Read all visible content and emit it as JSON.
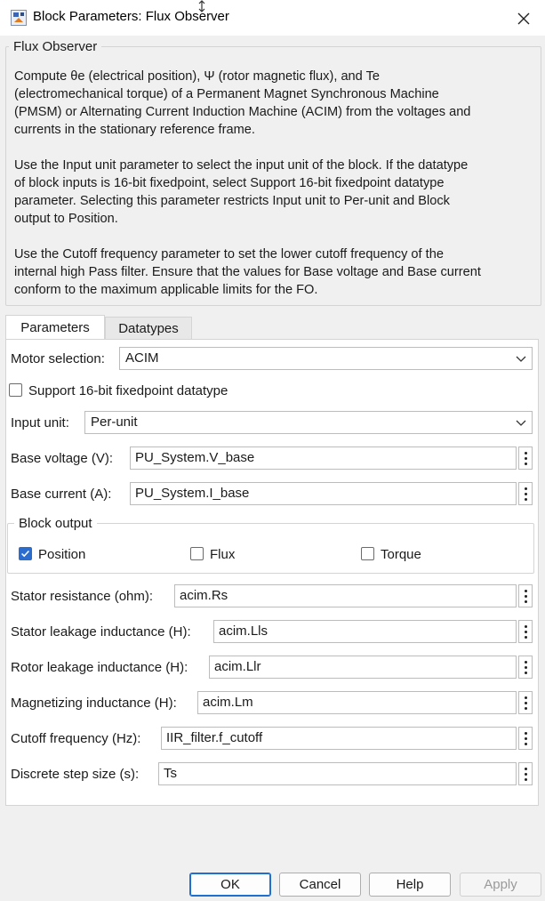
{
  "window": {
    "title": "Block Parameters: Flux Observer"
  },
  "description": {
    "group_title": "Flux Observer",
    "paragraphs": [
      "Compute θe (electrical position), Ψ (rotor magnetic flux), and Te\n(electromechanical torque) of a Permanent Magnet Synchronous Machine\n(PMSM) or Alternating Current Induction Machine (ACIM) from the voltages and\ncurrents in the stationary reference frame.",
      "Use the Input unit parameter to select the input unit of the block. If the datatype\nof block inputs is 16-bit fixedpoint, select Support 16-bit fixedpoint datatype\nparameter. Selecting this parameter restricts Input unit to Per-unit and Block\noutput to Position.",
      "Use the Cutoff frequency parameter to set the lower cutoff frequency of the\ninternal high Pass filter. Ensure that the values for Base voltage and Base current\nconform to the maximum applicable limits for the FO."
    ]
  },
  "tabs": {
    "parameters": "Parameters",
    "datatypes": "Datatypes"
  },
  "params": {
    "motor_selection": {
      "label": "Motor selection:",
      "value": "ACIM"
    },
    "support_16bit": {
      "label": "Support 16-bit fixedpoint datatype",
      "checked": false
    },
    "input_unit": {
      "label": "Input unit:",
      "value": "Per-unit"
    },
    "base_voltage": {
      "label": "Base voltage (V):",
      "value": "PU_System.V_base"
    },
    "base_current": {
      "label": "Base current (A):",
      "value": "PU_System.I_base"
    },
    "block_output": {
      "title": "Block output",
      "position": {
        "label": "Position",
        "checked": true
      },
      "flux": {
        "label": "Flux",
        "checked": false
      },
      "torque": {
        "label": "Torque",
        "checked": false
      }
    },
    "stator_resistance": {
      "label": "Stator resistance (ohm):",
      "value": "acim.Rs"
    },
    "stator_leakage": {
      "label": "Stator leakage inductance (H):",
      "value": "acim.Lls"
    },
    "rotor_leakage": {
      "label": "Rotor leakage inductance (H):",
      "value": "acim.Llr"
    },
    "magnetizing": {
      "label": "Magnetizing inductance (H):",
      "value": "acim.Lm"
    },
    "cutoff_frequency": {
      "label": "Cutoff frequency (Hz):",
      "value": "IIR_filter.f_cutoff"
    },
    "step_size": {
      "label": "Discrete step size (s):",
      "value": "Ts"
    }
  },
  "buttons": {
    "ok": "OK",
    "cancel": "Cancel",
    "help": "Help",
    "apply": "Apply"
  },
  "colors": {
    "accent": "#2b6dce",
    "background": "#f0f0f0",
    "panel": "#ffffff"
  }
}
